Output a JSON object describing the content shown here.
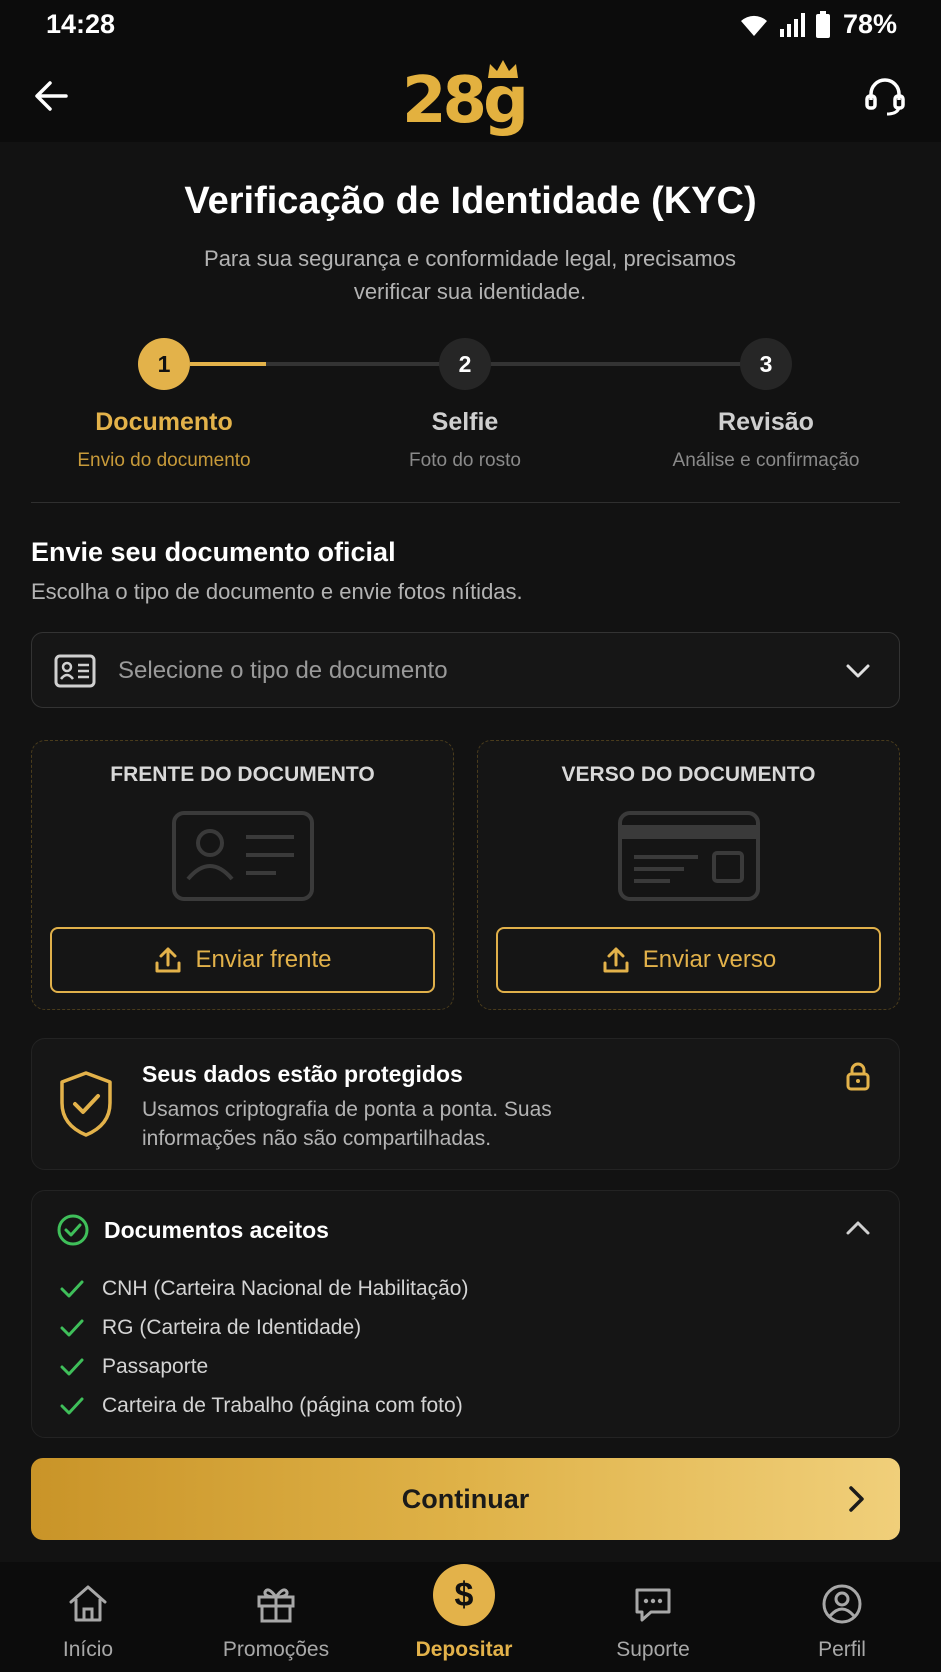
{
  "status_bar": {
    "time": "14:28",
    "battery": "78%"
  },
  "header": {
    "logo": "28g"
  },
  "page": {
    "title": "Verificação de Identidade (KYC)",
    "subtitle": "Para sua segurança e conformidade legal, precisamos verificar sua identidade."
  },
  "steps": [
    {
      "number": "1",
      "title": "Documento",
      "subtitle": "Envio do documento",
      "active": true
    },
    {
      "number": "2",
      "title": "Selfie",
      "subtitle": "Foto do rosto",
      "active": false
    },
    {
      "number": "3",
      "title": "Revisão",
      "subtitle": "Análise e confirmação",
      "active": false
    }
  ],
  "section": {
    "title": "Envie seu documento oficial",
    "subtitle": "Escolha o tipo de documento e envie fotos nítidas."
  },
  "doc_select": {
    "placeholder": "Selecione o tipo de documento"
  },
  "upload": {
    "front": {
      "label": "FRENTE DO DOCUMENTO",
      "button": "Enviar frente"
    },
    "back": {
      "label": "VERSO DO DOCUMENTO",
      "button": "Enviar verso"
    }
  },
  "protection": {
    "title": "Seus dados estão protegidos",
    "text": "Usamos criptografia de ponta a ponta. Suas informações não são compartilhadas."
  },
  "accepted": {
    "title": "Documentos aceitos",
    "items": [
      "CNH (Carteira Nacional de Habilitação)",
      "RG (Carteira de Identidade)",
      "Passaporte",
      "Carteira de Trabalho (página com foto)"
    ]
  },
  "continue_label": "Continuar",
  "nav": {
    "items": [
      {
        "label": "Início",
        "icon": "home-icon"
      },
      {
        "label": "Promoções",
        "icon": "gift-icon"
      },
      {
        "label": "Depositar",
        "icon": "dollar-icon",
        "active": true
      },
      {
        "label": "Suporte",
        "icon": "chat-icon"
      },
      {
        "label": "Perfil",
        "icon": "user-icon"
      }
    ]
  },
  "colors": {
    "accent": "#e3b24a",
    "background": "#121212",
    "success": "#3fbf5a"
  }
}
